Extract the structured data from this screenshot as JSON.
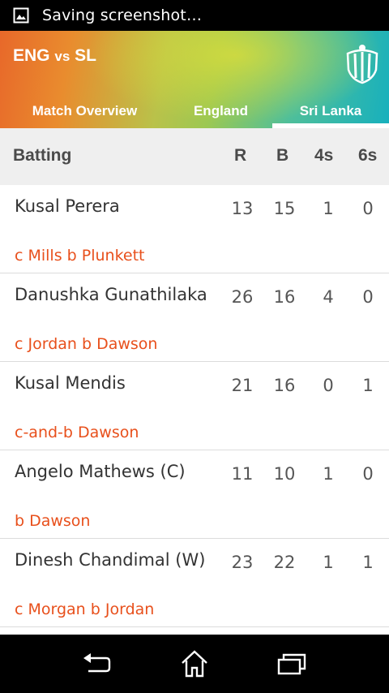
{
  "status_bar": {
    "text": "Saving screenshot…",
    "icon": "image-icon"
  },
  "header": {
    "team1": "ENG",
    "vs": "vs",
    "team2": "SL",
    "logo_icon": "cricket-shield-icon",
    "tabs": [
      {
        "label": "Match Overview",
        "selected": false
      },
      {
        "label": "England",
        "selected": false
      },
      {
        "label": "Sri Lanka",
        "selected": true
      }
    ]
  },
  "table": {
    "headers": {
      "section": "Batting",
      "r": "R",
      "b": "B",
      "fours": "4s",
      "sixes": "6s"
    },
    "rows": [
      {
        "name": "Kusal Perera",
        "r": "13",
        "b": "15",
        "fours": "1",
        "sixes": "0",
        "dismissal": "c Mills  b Plunkett"
      },
      {
        "name": "Danushka Gunathilaka",
        "r": "26",
        "b": "16",
        "fours": "4",
        "sixes": "0",
        "dismissal": "c Jordan  b Dawson"
      },
      {
        "name": "Kusal Mendis",
        "r": "21",
        "b": "16",
        "fours": "0",
        "sixes": "1",
        "dismissal": "c-and-b Dawson"
      },
      {
        "name": "Angelo Mathews (C)",
        "r": "11",
        "b": "10",
        "fours": "1",
        "sixes": "0",
        "dismissal": "b Dawson"
      },
      {
        "name": "Dinesh Chandimal (W)",
        "r": "23",
        "b": "22",
        "fours": "1",
        "sixes": "1",
        "dismissal": "c Morgan  b Jordan"
      }
    ]
  },
  "nav": {
    "back_icon": "back-icon",
    "home_icon": "home-icon",
    "recents_icon": "recents-icon"
  },
  "colors": {
    "dismissal": "#e8501c",
    "header_gradient_start": "#e8682a",
    "header_gradient_end": "#17b0bd"
  }
}
